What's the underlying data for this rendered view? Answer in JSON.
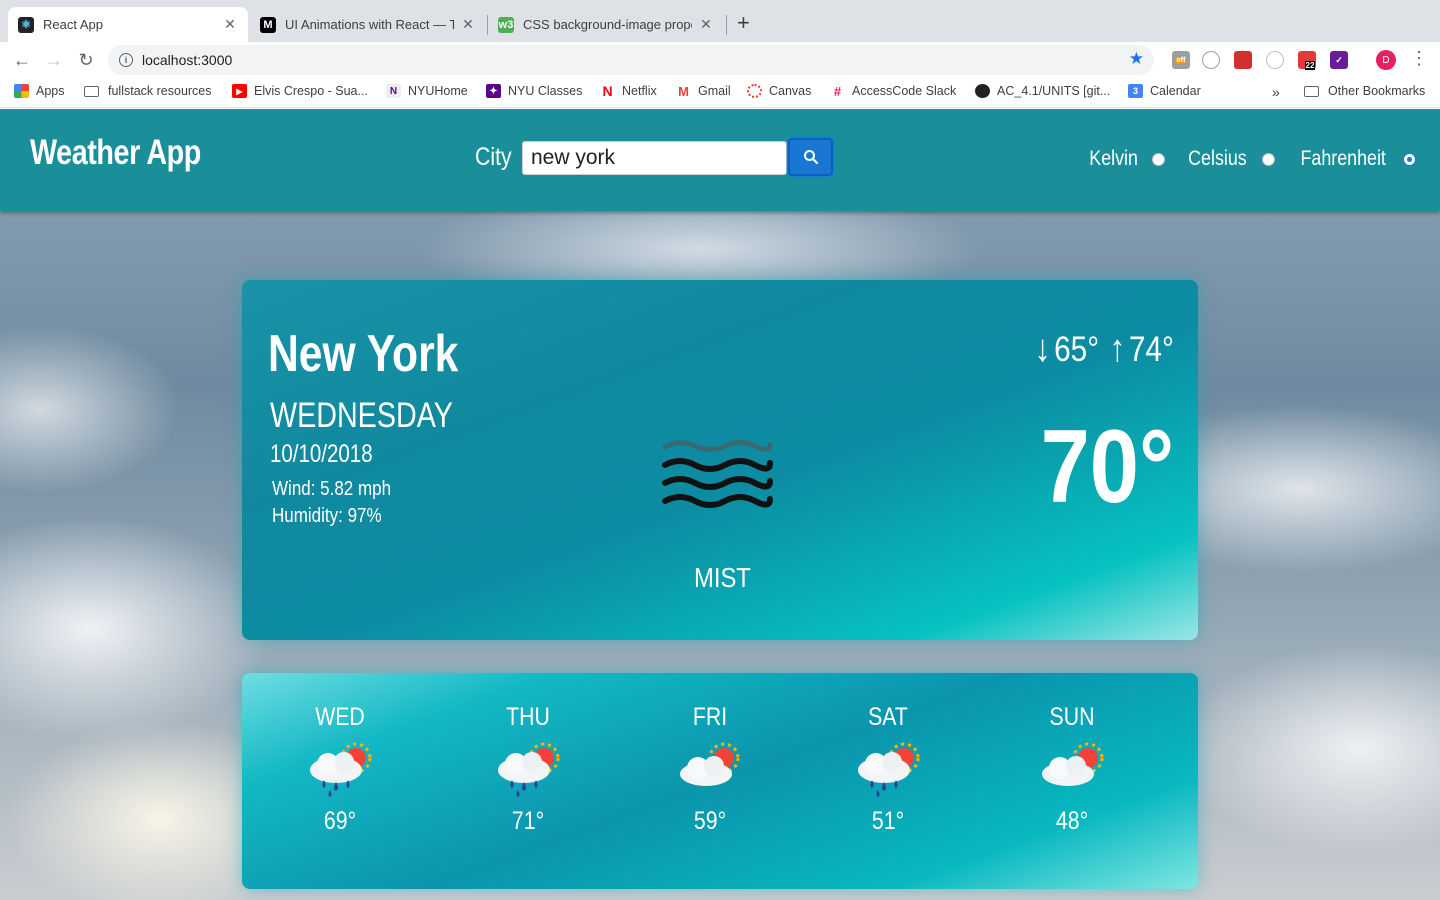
{
  "browser": {
    "tabs": [
      {
        "title": "React App",
        "favicon": "react-icon",
        "active": true
      },
      {
        "title": "UI Animations with React — Th",
        "favicon": "medium-icon",
        "active": false
      },
      {
        "title": "CSS background-image proper",
        "favicon": "w3schools-icon",
        "active": false
      }
    ],
    "url": "localhost:3000",
    "extension_badges": {
      "off": "off",
      "count": "22"
    },
    "avatar_letter": "D",
    "bookmarks": [
      {
        "label": "Apps",
        "icon": "apps-grid-icon"
      },
      {
        "label": "fullstack resources",
        "icon": "folder-icon"
      },
      {
        "label": "Elvis Crespo - Sua...",
        "icon": "youtube-icon"
      },
      {
        "label": "NYUHome",
        "icon": "nyu-icon"
      },
      {
        "label": "NYU Classes",
        "icon": "nyu-classes-icon"
      },
      {
        "label": "Netflix",
        "icon": "netflix-icon"
      },
      {
        "label": "Gmail",
        "icon": "gmail-icon"
      },
      {
        "label": "Canvas",
        "icon": "canvas-icon"
      },
      {
        "label": "AccessCode Slack",
        "icon": "slack-icon"
      },
      {
        "label": "AC_4.1/UNITS [git...",
        "icon": "github-icon"
      },
      {
        "label": "Calendar",
        "icon": "calendar-icon"
      },
      {
        "label": "Other Bookmarks",
        "icon": "folder-icon"
      }
    ],
    "bookmark_overflow": "»",
    "calendar_badge": "3"
  },
  "app": {
    "title": "Weather App",
    "city_label": "City",
    "city_value": "new york",
    "units": [
      {
        "label": "Kelvin",
        "checked": false
      },
      {
        "label": "Celsius",
        "checked": false
      },
      {
        "label": "Fahrenheit",
        "checked": true
      }
    ]
  },
  "current": {
    "city": "New York",
    "weekday": "WEDNESDAY",
    "date": "10/10/2018",
    "wind": "Wind: 5.82 mph",
    "humidity": "Humidity: 97%",
    "min": "65°",
    "max": "74°",
    "temp": "70°",
    "condition": "MIST",
    "condition_icon": "mist-icon"
  },
  "forecast": [
    {
      "day": "WED",
      "temp": "69°",
      "icon": "rain-sun-icon"
    },
    {
      "day": "THU",
      "temp": "71°",
      "icon": "rain-sun-icon"
    },
    {
      "day": "FRI",
      "temp": "59°",
      "icon": "cloud-sun-icon"
    },
    {
      "day": "SAT",
      "temp": "51°",
      "icon": "rain-sun-icon"
    },
    {
      "day": "SUN",
      "temp": "48°",
      "icon": "cloud-sun-icon"
    }
  ]
}
